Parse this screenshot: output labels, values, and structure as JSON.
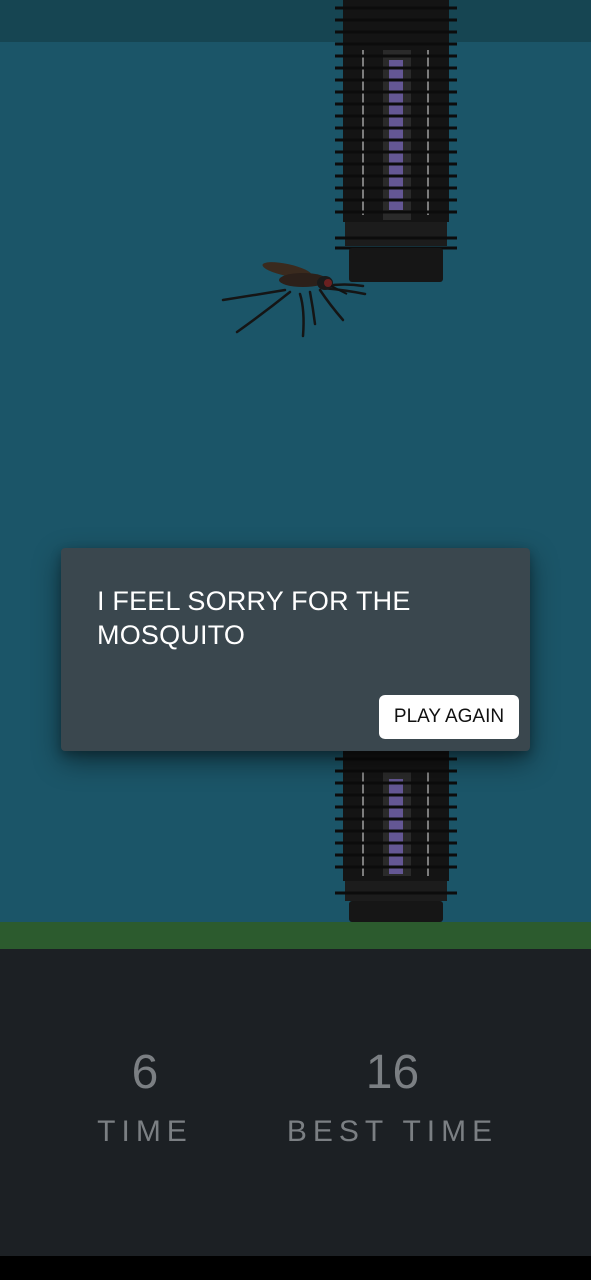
{
  "dialog": {
    "message": "I FEEL SORRY FOR THE MOSQUITO",
    "play_again_label": "PLAY AGAIN"
  },
  "scores": {
    "time_value": "6",
    "time_label": "TIME",
    "best_value": "16",
    "best_label": "BEST TIME"
  },
  "colors": {
    "sky": "#1b5568",
    "ground": "#2c5b2e",
    "panel": "#1c2024",
    "dialog": "#3a474e"
  }
}
